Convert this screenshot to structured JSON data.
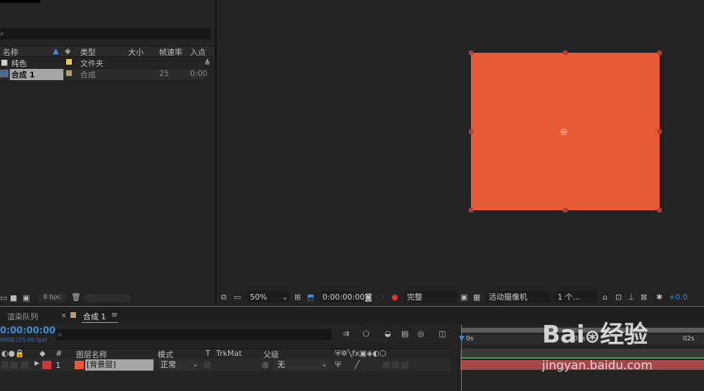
{
  "project": {
    "search_glyph": "⌕",
    "columns": [
      "名称",
      "类型",
      "大小",
      "帧速率",
      "入点"
    ],
    "items": [
      {
        "name": "纯色",
        "type": "文件夹",
        "color": "#e5cf4a",
        "framerate": "",
        "inpoint": ""
      },
      {
        "name": "合成 1",
        "type": "合成",
        "color": "#b59b73",
        "framerate": "25",
        "inpoint": "0:00"
      }
    ],
    "bpc": "8 bpc"
  },
  "viewer": {
    "solid_color": "#e55a33",
    "zoom": "50%",
    "timecode": "0:00:00:00",
    "resolution": "完整",
    "camera": "活动摄像机",
    "views": "1 个...",
    "exposure": "+0.0"
  },
  "timeline": {
    "tabs": [
      "渲染队列",
      "合成 1"
    ],
    "current_time": "0:00:00:00",
    "fps_sub": "0000 (25.00 fps)",
    "columns": [
      "#",
      "图层名称",
      "模式",
      "T",
      "TrkMat",
      "父级"
    ],
    "layer": {
      "index": "1",
      "name": "[背景层]",
      "mode": "正常",
      "parent": "无",
      "color": "#e55a33",
      "label_color": "#c43a3a"
    },
    "ruler": [
      "0s",
      "01s",
      "02s"
    ]
  },
  "colors": {
    "accent": "#3b72c4",
    "timecode": "#3b8bd6"
  }
}
